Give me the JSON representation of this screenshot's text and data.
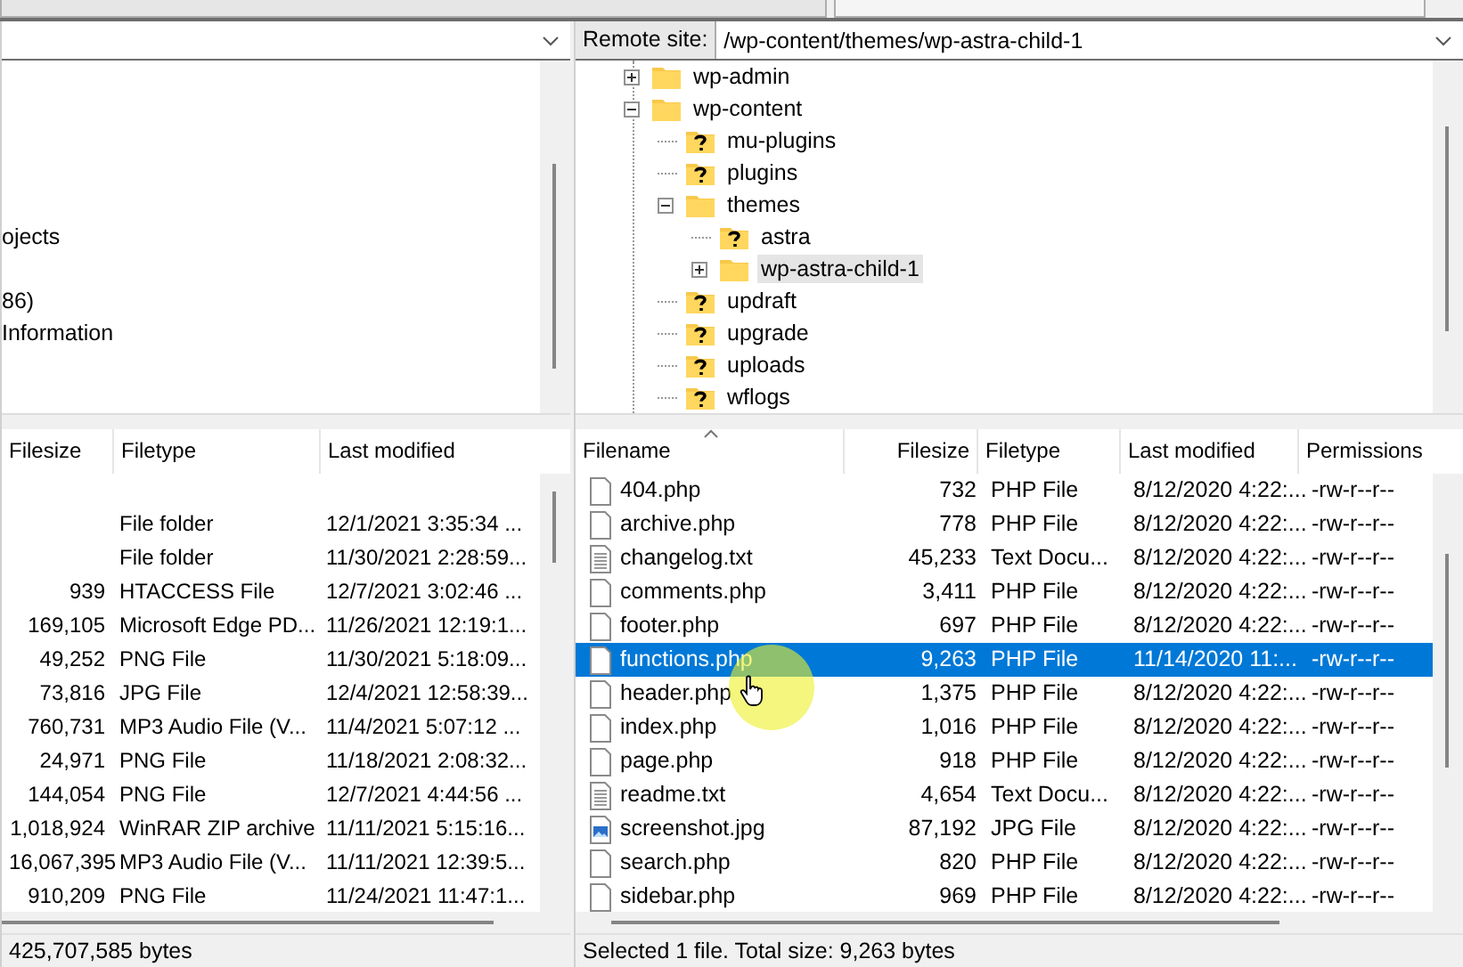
{
  "local": {
    "tree_fragments": [
      {
        "text": "ojects"
      },
      {
        "text": "86)"
      },
      {
        "text": "Information"
      }
    ],
    "columns": [
      "Filesize",
      "Filetype",
      "Last modified"
    ],
    "rows": [
      {
        "type": "File folder",
        "modified": "12/1/2021 3:35:34 ..."
      },
      {
        "type": "File folder",
        "modified": "11/30/2021 2:28:59..."
      },
      {
        "size": "939",
        "type": "HTACCESS File",
        "modified": "12/7/2021 3:02:46 ..."
      },
      {
        "size": "169,105",
        "type": "Microsoft Edge PD...",
        "modified": "11/26/2021 12:19:1..."
      },
      {
        "size": "49,252",
        "type": "PNG File",
        "modified": "11/30/2021 5:18:09..."
      },
      {
        "size": "73,816",
        "type": "JPG File",
        "modified": "12/4/2021 12:58:39..."
      },
      {
        "size": "760,731",
        "type": "MP3 Audio File (V...",
        "modified": "11/4/2021 5:07:12 ..."
      },
      {
        "size": "24,971",
        "type": "PNG File",
        "modified": "11/18/2021 2:08:32..."
      },
      {
        "size": "144,054",
        "type": "PNG File",
        "modified": "12/7/2021 4:44:56 ..."
      },
      {
        "size": "1,018,924",
        "type": "WinRAR ZIP archive",
        "modified": "11/11/2021 5:15:16..."
      },
      {
        "size": "16,067,395",
        "type": "MP3 Audio File (V...",
        "modified": "11/11/2021 12:39:5..."
      },
      {
        "size": "910,209",
        "type": "PNG File",
        "modified": "11/24/2021 11:47:1..."
      }
    ],
    "status": "425,707,585 bytes"
  },
  "remote": {
    "label": "Remote site:",
    "path": "/wp-content/themes/wp-astra-child-1",
    "tree": [
      {
        "name": "wp-admin",
        "kind": "folder",
        "expanded": false,
        "selected": false
      },
      {
        "name": "wp-content",
        "kind": "folder",
        "expanded": true,
        "selected": false,
        "children": [
          {
            "name": "mu-plugins",
            "kind": "unknown",
            "selected": false
          },
          {
            "name": "plugins",
            "kind": "unknown",
            "selected": false
          },
          {
            "name": "themes",
            "kind": "folder",
            "expanded": true,
            "selected": false,
            "children": [
              {
                "name": "astra",
                "kind": "unknown",
                "selected": false
              },
              {
                "name": "wp-astra-child-1",
                "kind": "folder",
                "expanded": false,
                "selected": true
              }
            ]
          },
          {
            "name": "updraft",
            "kind": "unknown",
            "selected": false
          },
          {
            "name": "upgrade",
            "kind": "unknown",
            "selected": false
          },
          {
            "name": "uploads",
            "kind": "unknown",
            "selected": false
          },
          {
            "name": "wflogs",
            "kind": "unknown",
            "selected": false
          }
        ]
      }
    ],
    "columns": [
      "Filename",
      "Filesize",
      "Filetype",
      "Last modified",
      "Permissions"
    ],
    "rows": [
      {
        "name": "404.php",
        "kind": "document",
        "size": "732",
        "type": "PHP File",
        "modified": "8/12/2020 4:22:...",
        "perms": "-rw-r--r--",
        "selected": false
      },
      {
        "name": "archive.php",
        "kind": "document",
        "size": "778",
        "type": "PHP File",
        "modified": "8/12/2020 4:22:...",
        "perms": "-rw-r--r--",
        "selected": false
      },
      {
        "name": "changelog.txt",
        "kind": "text",
        "size": "45,233",
        "type": "Text Docu...",
        "modified": "8/12/2020 4:22:...",
        "perms": "-rw-r--r--",
        "selected": false
      },
      {
        "name": "comments.php",
        "kind": "document",
        "size": "3,411",
        "type": "PHP File",
        "modified": "8/12/2020 4:22:...",
        "perms": "-rw-r--r--",
        "selected": false
      },
      {
        "name": "footer.php",
        "kind": "document",
        "size": "697",
        "type": "PHP File",
        "modified": "8/12/2020 4:22:...",
        "perms": "-rw-r--r--",
        "selected": false
      },
      {
        "name": "functions.php",
        "kind": "document",
        "size": "9,263",
        "type": "PHP File",
        "modified": "11/14/2020 11:...",
        "perms": "-rw-r--r--",
        "selected": true
      },
      {
        "name": "header.php",
        "kind": "document",
        "size": "1,375",
        "type": "PHP File",
        "modified": "8/12/2020 4:22:...",
        "perms": "-rw-r--r--",
        "selected": false
      },
      {
        "name": "index.php",
        "kind": "document",
        "size": "1,016",
        "type": "PHP File",
        "modified": "8/12/2020 4:22:...",
        "perms": "-rw-r--r--",
        "selected": false
      },
      {
        "name": "page.php",
        "kind": "document",
        "size": "918",
        "type": "PHP File",
        "modified": "8/12/2020 4:22:...",
        "perms": "-rw-r--r--",
        "selected": false
      },
      {
        "name": "readme.txt",
        "kind": "text",
        "size": "4,654",
        "type": "Text Docu...",
        "modified": "8/12/2020 4:22:...",
        "perms": "-rw-r--r--",
        "selected": false
      },
      {
        "name": "screenshot.jpg",
        "kind": "image",
        "size": "87,192",
        "type": "JPG File",
        "modified": "8/12/2020 4:22:...",
        "perms": "-rw-r--r--",
        "selected": false
      },
      {
        "name": "search.php",
        "kind": "document",
        "size": "820",
        "type": "PHP File",
        "modified": "8/12/2020 4:22:...",
        "perms": "-rw-r--r--",
        "selected": false
      },
      {
        "name": "sidebar.php",
        "kind": "document",
        "size": "969",
        "type": "PHP File",
        "modified": "8/12/2020 4:22:...",
        "perms": "-rw-r--r--",
        "selected": false
      }
    ],
    "status": "Selected 1 file. Total size: 9,263 bytes"
  }
}
